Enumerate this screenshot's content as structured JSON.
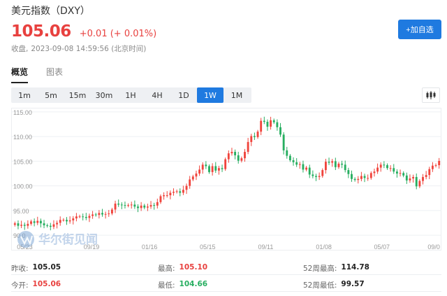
{
  "header": {
    "title": "美元指数（DXY）",
    "price": "105.06",
    "change": "+0.01 (+ 0.01%)",
    "close_label": "收盘,",
    "close_time": "2023-09-08 14:59:56 (北京时间)",
    "add_button": "+加自选"
  },
  "tabs": [
    {
      "label": "概览",
      "active": true
    },
    {
      "label": "图表",
      "active": false
    }
  ],
  "periods": [
    {
      "label": "1m",
      "active": false
    },
    {
      "label": "5m",
      "active": false
    },
    {
      "label": "15m",
      "active": false
    },
    {
      "label": "30m",
      "active": false
    },
    {
      "label": "1H",
      "active": false
    },
    {
      "label": "4H",
      "active": false
    },
    {
      "label": "1D",
      "active": false
    },
    {
      "label": "1W",
      "active": true
    },
    {
      "label": "1M",
      "active": false
    }
  ],
  "chart_type_icon": "candlestick-icon",
  "watermark": "华尔街见闻",
  "colors": {
    "up": "#f0443c",
    "down": "#27ae60",
    "accent": "#1f7ae0"
  },
  "chart_data": {
    "type": "candlestick",
    "y_ticks": [
      "115.00",
      "110.00",
      "105.00",
      "100.00",
      "95.00",
      "90.0"
    ],
    "ylim": [
      89.3,
      115.7
    ],
    "x_ticks": [
      "05/23",
      "09/19",
      "01/16",
      "05/15",
      "09/11",
      "01/08",
      "05/07",
      "09/0"
    ],
    "closes": [
      92.4,
      91.9,
      92.1,
      91.9,
      92.3,
      92.8,
      92.5,
      92.9,
      92.4,
      92.0,
      91.9,
      91.7,
      92.2,
      92.5,
      93.1,
      93.1,
      92.8,
      93.0,
      93.4,
      93.8,
      93.8,
      93.7,
      93.5,
      93.9,
      94.2,
      94.1,
      94.5,
      94.2,
      94.3,
      94.4,
      95.2,
      96.4,
      96.2,
      96.1,
      96.0,
      96.1,
      96.2,
      95.8,
      95.5,
      96.0,
      95.6,
      95.8,
      96.1,
      96.0,
      96.7,
      97.9,
      98.1,
      98.1,
      98.6,
      98.8,
      98.9,
      98.6,
      99.2,
      100.0,
      101.3,
      101.9,
      102.5,
      103.3,
      104.3,
      104.0,
      102.8,
      104.0,
      103.1,
      103.6,
      103.4,
      105.4,
      106.6,
      106.9,
      106.2,
      105.1,
      105.6,
      106.9,
      108.9,
      110.1,
      109.9,
      111.0,
      113.2,
      113.0,
      112.0,
      113.3,
      112.9,
      111.9,
      110.4,
      107.2,
      106.1,
      105.2,
      104.8,
      104.3,
      104.4,
      103.3,
      103.7,
      102.3,
      102.0,
      101.8,
      102.0,
      103.2,
      104.9,
      104.7,
      105.0,
      103.8,
      104.5,
      104.3,
      103.2,
      102.4,
      101.4,
      101.2,
      101.4,
      102.0,
      101.6,
      101.6,
      102.6,
      102.9,
      103.7,
      104.3,
      104.2,
      103.6,
      103.6,
      102.9,
      102.5,
      102.6,
      102.1,
      101.1,
      101.5,
      101.8,
      99.9,
      101.0,
      101.8,
      102.2,
      103.4,
      104.1,
      104.2,
      105.06
    ]
  },
  "stats": {
    "prev_close_label": "昨收:",
    "prev_close": "105.05",
    "high_label": "最高:",
    "high": "105.10",
    "high52_label": "52周最高:",
    "high52": "114.78",
    "open_label": "今开:",
    "open": "105.06",
    "low_label": "最低:",
    "low": "104.66",
    "low52_label": "52周最低:",
    "low52": "99.57"
  }
}
